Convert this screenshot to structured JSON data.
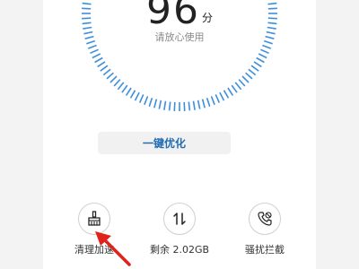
{
  "score": {
    "value": "96",
    "unit": "分",
    "subtitle": "请放心使用"
  },
  "actions": {
    "optimize_label": "一键优化"
  },
  "tools": [
    {
      "label": "清理加速",
      "icon": "broom-icon"
    },
    {
      "label": "剩余 2.02GB",
      "icon": "transfer-arrows-icon"
    },
    {
      "label": "骚扰拦截",
      "icon": "phone-block-icon"
    }
  ],
  "colors": {
    "accent": "#1f6cb3",
    "dial_tick": "#3d8fdc",
    "arrow": "#e0221b"
  }
}
